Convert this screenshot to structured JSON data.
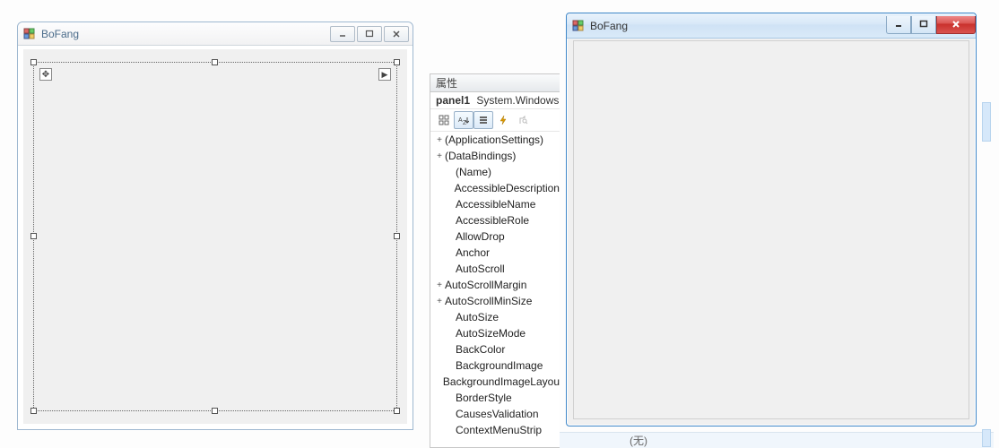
{
  "designer": {
    "title": "BoFang",
    "buttons": {
      "min": "—",
      "max": "▭",
      "close": "✕"
    },
    "selected_control": "panel1",
    "move_glyph": "✥",
    "play_glyph": "▶"
  },
  "properties": {
    "header": "属性",
    "object_name": "panel1",
    "object_type": "System.Windows.F",
    "toolbar": {
      "categorized": "▦",
      "alphabetical": "A↓",
      "props": "▤",
      "events": "⚡",
      "pages": "✎"
    },
    "rows": [
      {
        "exp": "+",
        "indent": 0,
        "name": "(ApplicationSettings)"
      },
      {
        "exp": "+",
        "indent": 0,
        "name": "(DataBindings)"
      },
      {
        "exp": "",
        "indent": 1,
        "name": "(Name)"
      },
      {
        "exp": "",
        "indent": 1,
        "name": "AccessibleDescription"
      },
      {
        "exp": "",
        "indent": 1,
        "name": "AccessibleName"
      },
      {
        "exp": "",
        "indent": 1,
        "name": "AccessibleRole"
      },
      {
        "exp": "",
        "indent": 1,
        "name": "AllowDrop"
      },
      {
        "exp": "",
        "indent": 1,
        "name": "Anchor"
      },
      {
        "exp": "",
        "indent": 1,
        "name": "AutoScroll"
      },
      {
        "exp": "+",
        "indent": 0,
        "name": "AutoScrollMargin"
      },
      {
        "exp": "+",
        "indent": 0,
        "name": "AutoScrollMinSize"
      },
      {
        "exp": "",
        "indent": 1,
        "name": "AutoSize"
      },
      {
        "exp": "",
        "indent": 1,
        "name": "AutoSizeMode"
      },
      {
        "exp": "",
        "indent": 1,
        "name": "BackColor"
      },
      {
        "exp": "",
        "indent": 1,
        "name": "BackgroundImage"
      },
      {
        "exp": "",
        "indent": 1,
        "name": "BackgroundImageLayou"
      },
      {
        "exp": "",
        "indent": 1,
        "name": "BorderStyle"
      },
      {
        "exp": "",
        "indent": 1,
        "name": "CausesValidation"
      },
      {
        "exp": "",
        "indent": 1,
        "name": "ContextMenuStrip"
      }
    ],
    "bottom_value": "(无)"
  },
  "runtime": {
    "title": "BoFang"
  }
}
